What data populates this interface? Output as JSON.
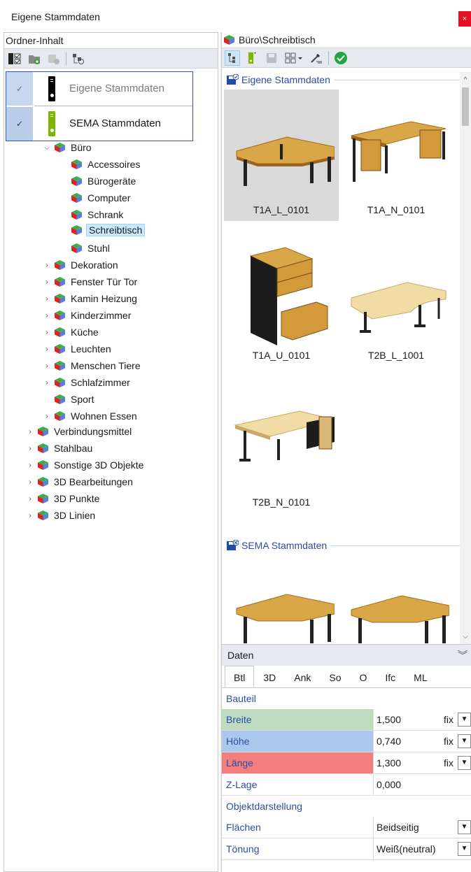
{
  "window": {
    "title": "Eigene Stammdaten",
    "close_label": "×"
  },
  "left": {
    "header": "Ordner-Inhalt",
    "stammdaten": [
      {
        "label": "Eigene Stammdaten",
        "color": "#000000"
      },
      {
        "label": "SEMA Stammdaten",
        "color": "#7ab800"
      }
    ],
    "tree": [
      {
        "label": "Büro"
      },
      {
        "label": "Accessoires"
      },
      {
        "label": "Bürogeräte"
      },
      {
        "label": "Computer"
      },
      {
        "label": "Schrank"
      },
      {
        "label": "Schreibtisch"
      },
      {
        "label": "Stuhl"
      },
      {
        "label": "Dekoration"
      },
      {
        "label": "Fenster Tür Tor"
      },
      {
        "label": "Kamin Heizung"
      },
      {
        "label": "Kinderzimmer"
      },
      {
        "label": "Küche"
      },
      {
        "label": "Leuchten"
      },
      {
        "label": "Menschen Tiere"
      },
      {
        "label": "Schlafzimmer"
      },
      {
        "label": "Sport"
      },
      {
        "label": "Wohnen Essen"
      },
      {
        "label": "Verbindungsmittel"
      },
      {
        "label": "Stahlbau"
      },
      {
        "label": "Sonstige 3D Objekte"
      },
      {
        "label": "3D Bearbeitungen"
      },
      {
        "label": "3D Punkte"
      },
      {
        "label": "3D Linien"
      }
    ]
  },
  "right": {
    "header": "Büro\\Schreibtisch",
    "groups": [
      {
        "label": "Eigene Stammdaten"
      },
      {
        "label": "SEMA Stammdaten"
      }
    ],
    "items": [
      {
        "label": "T1A_L_0101"
      },
      {
        "label": "T1A_N_0101"
      },
      {
        "label": "T1A_U_0101"
      },
      {
        "label": "T2B_L_1001"
      },
      {
        "label": "T2B_N_0101"
      }
    ]
  },
  "data": {
    "header": "Daten",
    "tabs": [
      "Btl",
      "3D",
      "Ank",
      "So",
      "O",
      "Ifc",
      "ML"
    ],
    "section1": "Bauteil",
    "section2": "Objektdarstellung",
    "rows": [
      {
        "name": "Breite",
        "value": "1,500",
        "mode": "fix",
        "color": "#bfdcc0"
      },
      {
        "name": "Höhe",
        "value": "0,740",
        "mode": "fix",
        "color": "#a9c8ec"
      },
      {
        "name": "Länge",
        "value": "1,300",
        "mode": "fix",
        "color": "#f27e7e"
      },
      {
        "name": "Z-Lage",
        "value": "0,000",
        "mode": ""
      }
    ],
    "rows2": [
      {
        "name": "Flächen",
        "value": "Beidseitig"
      },
      {
        "name": "Tönung",
        "value": "Weiß(neutral)"
      }
    ]
  }
}
